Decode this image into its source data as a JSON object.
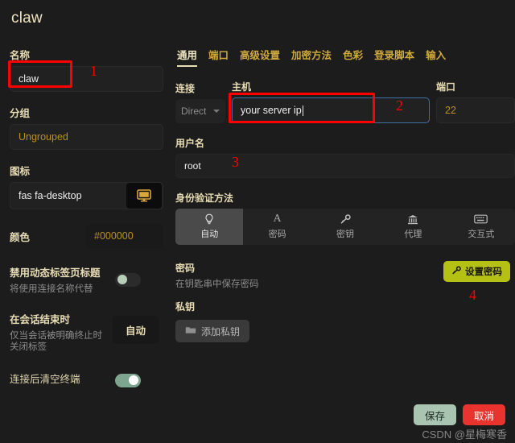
{
  "window": {
    "title": "claw"
  },
  "left": {
    "name_label": "名称",
    "name_value": "claw",
    "group_label": "分组",
    "group_value": "Ungrouped",
    "icon_label": "图标",
    "icon_value": "fas fa-desktop",
    "icon_preview": "desktop-monitor-icon",
    "color_label": "颜色",
    "color_value": "#000000",
    "disable_dynamic_title_label": "禁用动态标签页标题",
    "disable_dynamic_title_sub": "将使用连接名称代替",
    "disable_dynamic_title_state": "off",
    "session_end_label": "在会话结束时",
    "session_end_sub": "仅当会话被明确终止时关闭标签",
    "session_end_value": "自动",
    "clear_terminal_label": "连接后清空终端",
    "clear_terminal_state": "on"
  },
  "right": {
    "tabs": [
      {
        "label": "通用",
        "active": true
      },
      {
        "label": "端口",
        "active": false
      },
      {
        "label": "高级设置",
        "active": false
      },
      {
        "label": "加密方法",
        "active": false
      },
      {
        "label": "色彩",
        "active": false
      },
      {
        "label": "登录脚本",
        "active": false
      },
      {
        "label": "输入",
        "active": false
      }
    ],
    "connection_label": "连接",
    "connection_value": "Direct",
    "host_label": "主机",
    "host_value": "your server ip",
    "port_label": "端口",
    "port_value": "22",
    "username_label": "用户名",
    "username_value": "root",
    "auth_label": "身份验证方法",
    "auth_methods": [
      {
        "label": "自动",
        "icon": "lightbulb-icon",
        "active": true
      },
      {
        "label": "密码",
        "icon": "letter-a-icon",
        "active": false
      },
      {
        "label": "密钥",
        "icon": "key-icon",
        "active": false
      },
      {
        "label": "代理",
        "icon": "bank-proxy-icon",
        "active": false
      },
      {
        "label": "交互式",
        "icon": "keyboard-icon",
        "active": false
      }
    ],
    "password_label": "密码",
    "password_sub": "在钥匙串中保存密码",
    "set_password_button": "设置密码",
    "private_key_label": "私钥",
    "add_private_key_button": "添加私钥"
  },
  "footer": {
    "save_label": "保存",
    "cancel_label": "取消",
    "watermark": "CSDN @星梅寒香"
  },
  "annotations": [
    {
      "number": "1"
    },
    {
      "number": "2"
    },
    {
      "number": "3"
    },
    {
      "number": "4"
    }
  ],
  "colors": {
    "accent_gold": "#e8dcb4",
    "highlight_red": "#ff0000",
    "set_password_bg": "#b5c015",
    "save_bg": "#a9c5b2",
    "cancel_bg": "#e8332e",
    "toggle_on": "#7ea58f",
    "host_focus_border": "#3f6fa8"
  }
}
